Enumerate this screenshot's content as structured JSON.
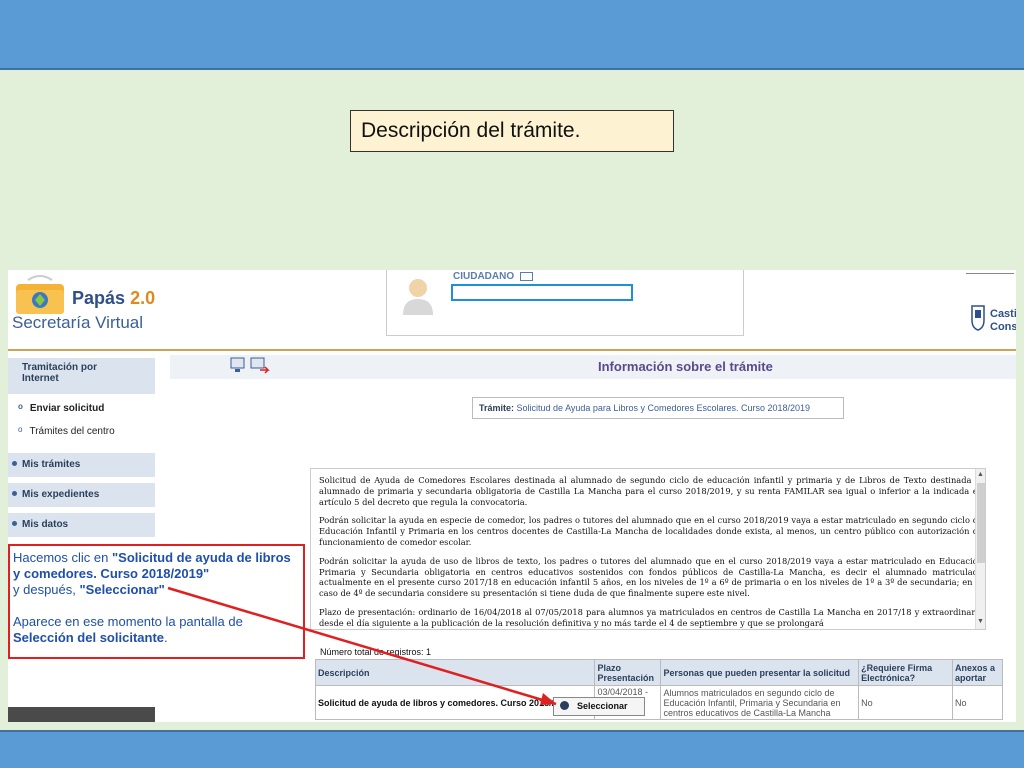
{
  "slide": {
    "title": "Descripción del  trámite."
  },
  "app": {
    "name": "Papás",
    "version": "2.0",
    "subtitle": "Secretaría Virtual",
    "citizen_label": "CIUDADANO",
    "region_line1": "Castil",
    "region_line2": "Conse"
  },
  "sidebar": {
    "section_title_line1": "Tramitación por",
    "section_title_line2": "Internet",
    "sub_items": [
      "Enviar solicitud",
      "Trámites del centro"
    ],
    "items": [
      "Mis trámites",
      "Mis expedientes",
      "Mis datos"
    ]
  },
  "main": {
    "title": "Información sobre el trámite",
    "tramite_label": "Trámite:",
    "tramite_value": "Solicitud de Ayuda para Libros y Comedores Escolares. Curso 2018/2019",
    "description": [
      "Solicitud de Ayuda de Comedores Escolares destinada al alumnado de segundo ciclo de educación infantil y primaria y de Libros de Texto destinada al alumnado de primaria y secundaria obligatoria de Castilla La Mancha para el curso 2018/2019, y su renta FAMILAR sea igual o inferior a la indicada en artículo 5 del decreto que regula la convocatoria.",
      "Podrán solicitar la ayuda en especie de comedor, los padres o tutores del alumnado que en el curso 2018/2019 vaya a estar matriculado en segundo ciclo de Educación Infantil y Primaria en los centros docentes de Castilla-La Mancha de localidades donde exista, al menos, un centro público con autorización de funcionamiento de comedor escolar.",
      "Podrán solicitar la ayuda de uso de libros de texto, los padres o tutores del alumnado que en el curso 2018/2019 vaya a estar matriculado en Educación Primaria y Secundaria obligatoria en centros educativos sostenidos con fondos públicos de Castilla-La Mancha, es decir el alumnado matriculado actualmente en el presente curso 2017/18 en educación infantil 5 años, en los niveles de 1º a 6º de primaria o en los niveles de 1º a 3º de secundaria; en el caso de 4º de secundaria considere su presentación si tiene duda de que finalmente supere este nivel.",
      "Plazo de presentación: ordinario de 16/04/2018 al 07/05/2018 para alumnos ya matriculados en centros de Castilla La Mancha en 2017/18 y extraordinario desde el día siguiente a la publicación de la resolución definitiva y no más tarde el 4 de septiembre y que se prolongará"
    ],
    "record_count": "Número total de registros: 1",
    "table": {
      "headers": [
        "Descripción",
        "Plazo Presentación",
        "Personas que pueden presentar la solicitud",
        "¿Requiere Firma Electrónica?",
        "Anexos a aportar"
      ],
      "row": {
        "description": "Solicitud de ayuda de libros y comedores. Curso 2018/2019",
        "plazo": "03/04/2018 -",
        "personas": "Alumnos matriculados en segundo ciclo de Educación Infantil, Primaria y Secundaria en centros educativos de Castilla-La Mancha",
        "firma": "No",
        "anexos": "No"
      }
    },
    "select_button": "Seleccionar"
  },
  "annotation": {
    "line1_a": "Hacemos clic en ",
    "line1_b": "\"Solicitud de ayuda de libros y comedores. Curso 2018/2019\"",
    "line2_a": "y después, ",
    "line2_b": "\"Seleccionar\"",
    "line3_a": "Aparece en ese momento la pantalla de ",
    "line3_b": "Selección del solicitante",
    "line3_c": "."
  },
  "colors": {
    "bar": "#5b9bd5",
    "slide_bg": "#e2efd9",
    "annotation_border": "#e02020",
    "annotation_text": "#1f4fa8"
  }
}
